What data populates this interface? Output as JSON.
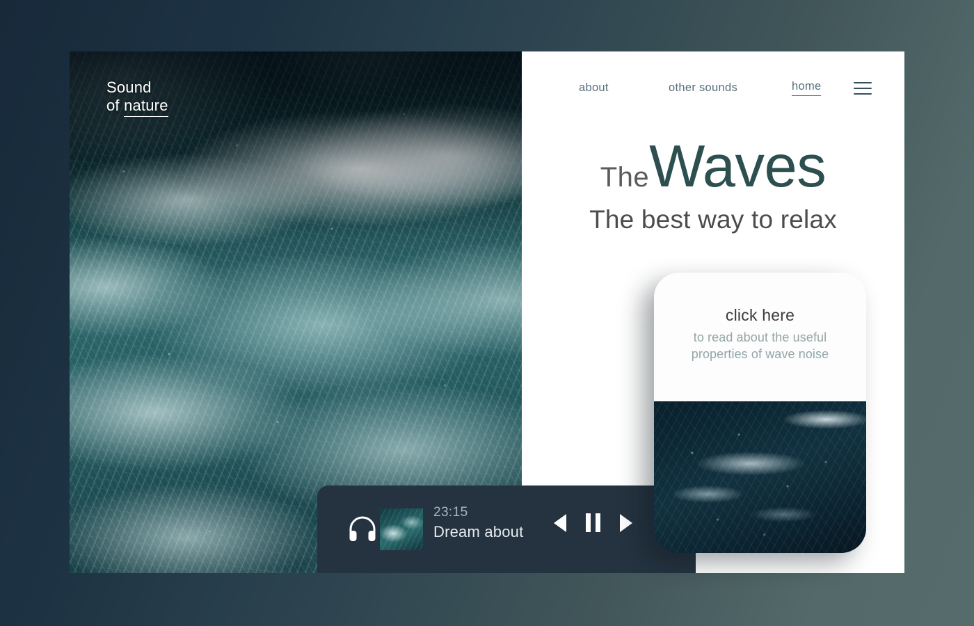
{
  "brand": {
    "line1": "Sound",
    "line2_prefix": "of ",
    "line2_underlined": "nature"
  },
  "nav": {
    "items": [
      {
        "label": "about",
        "active": false
      },
      {
        "label": "other sounds",
        "active": false
      },
      {
        "label": "home",
        "active": true
      }
    ],
    "menu_icon": "hamburger-icon"
  },
  "hero": {
    "headline_small": "The",
    "headline_large": "Waves",
    "subheadline": "The best way to relax",
    "image_alt": "aerial-ocean-waves-photo"
  },
  "promo_card": {
    "title": "click here",
    "description": "to read about the useful properties of wave noise",
    "image_alt": "dark-ocean-wave-photo"
  },
  "player": {
    "headphones_icon": "headphones-icon",
    "thumbnail_alt": "wave-thumbnail",
    "time": "23:15",
    "track_title": "Dream about",
    "controls": {
      "previous": "previous-icon",
      "pause": "pause-icon",
      "next": "next-icon"
    }
  },
  "colors": {
    "page_bg_dark": "#1d3343",
    "page_bg_light": "#566c6c",
    "panel_bg": "#ffffff",
    "heading_accent": "#2d4f4f",
    "heading_muted": "#5b5b5b",
    "nav_text": "#56707a",
    "card_sub_text": "#93a5a5",
    "player_bg": "#253340",
    "player_time": "#a9b6bd",
    "player_track": "#e6ecef"
  }
}
